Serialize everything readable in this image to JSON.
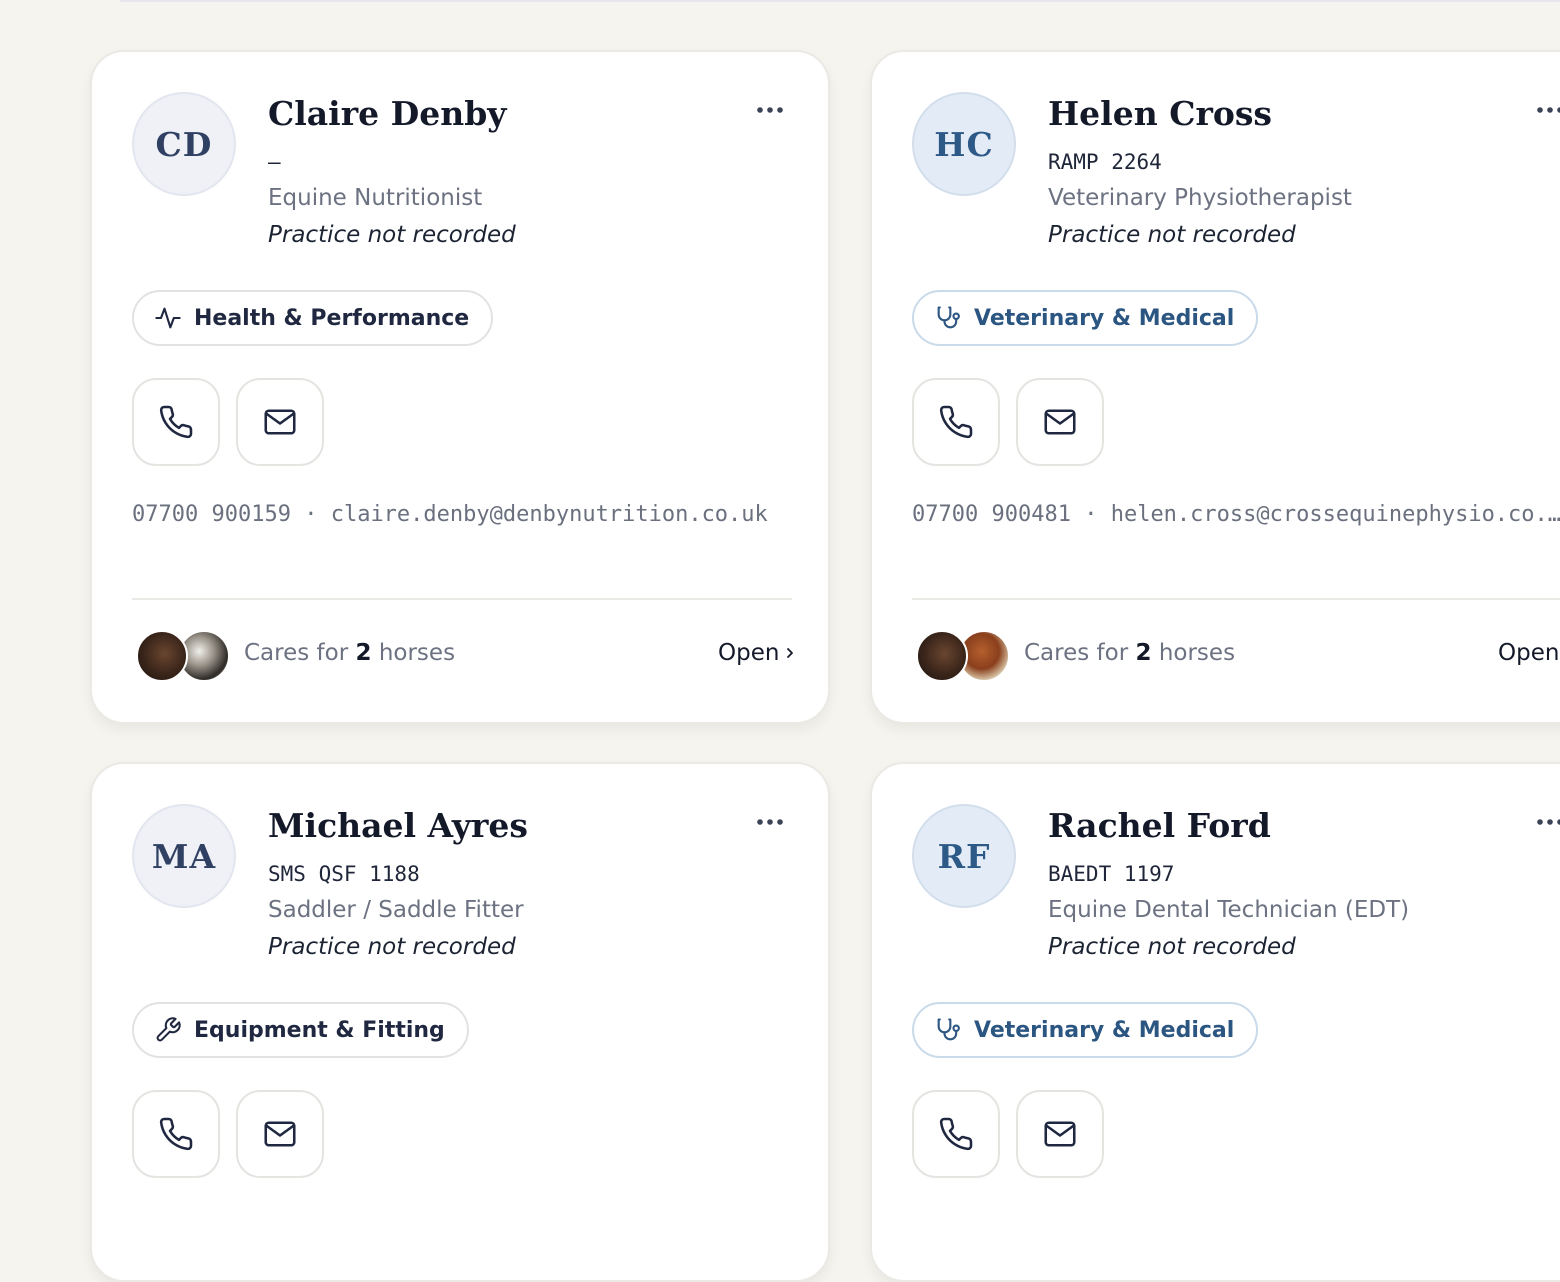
{
  "cards": [
    {
      "initials": "CD",
      "name": "Claire Denby",
      "registration": "–",
      "role": "Equine Nutritionist",
      "practice": "Practice not recorded",
      "category": "Health & Performance",
      "category_icon": "activity-icon",
      "phone": "07700 900159",
      "separator": "·",
      "email": "claire.denby@denbynutrition.co.uk",
      "cares_prefix": "Cares for",
      "horse_count": "2",
      "cares_suffix": "horses",
      "open_label": "Open"
    },
    {
      "initials": "HC",
      "name": "Helen Cross",
      "registration": "RAMP 2264",
      "role": "Veterinary Physiotherapist",
      "practice": "Practice not recorded",
      "category": "Veterinary & Medical",
      "category_icon": "stethoscope-icon",
      "phone": "07700 900481",
      "separator": "·",
      "email": "helen.cross@crossequinephysio.co.uk",
      "cares_prefix": "Cares for",
      "horse_count": "2",
      "cares_suffix": "horses",
      "open_label": "Open"
    },
    {
      "initials": "MA",
      "name": "Michael Ayres",
      "registration": "SMS QSF 1188",
      "role": "Saddler / Saddle Fitter",
      "practice": "Practice not recorded",
      "category": "Equipment & Fitting",
      "category_icon": "wrench-icon"
    },
    {
      "initials": "RF",
      "name": "Rachel Ford",
      "registration": "BAEDT 1197",
      "role": "Equine Dental Technician (EDT)",
      "practice": "Practice not recorded",
      "category": "Veterinary & Medical",
      "category_icon": "stethoscope-icon"
    }
  ],
  "colors": {
    "background": "#f6f4ef",
    "card": "#ffffff",
    "avatar_neutral": "#eff1f6",
    "avatar_blue": "#e3ecf6",
    "accent_blue": "#2c5682",
    "text_primary": "#14192a",
    "text_muted": "#6c7281"
  }
}
